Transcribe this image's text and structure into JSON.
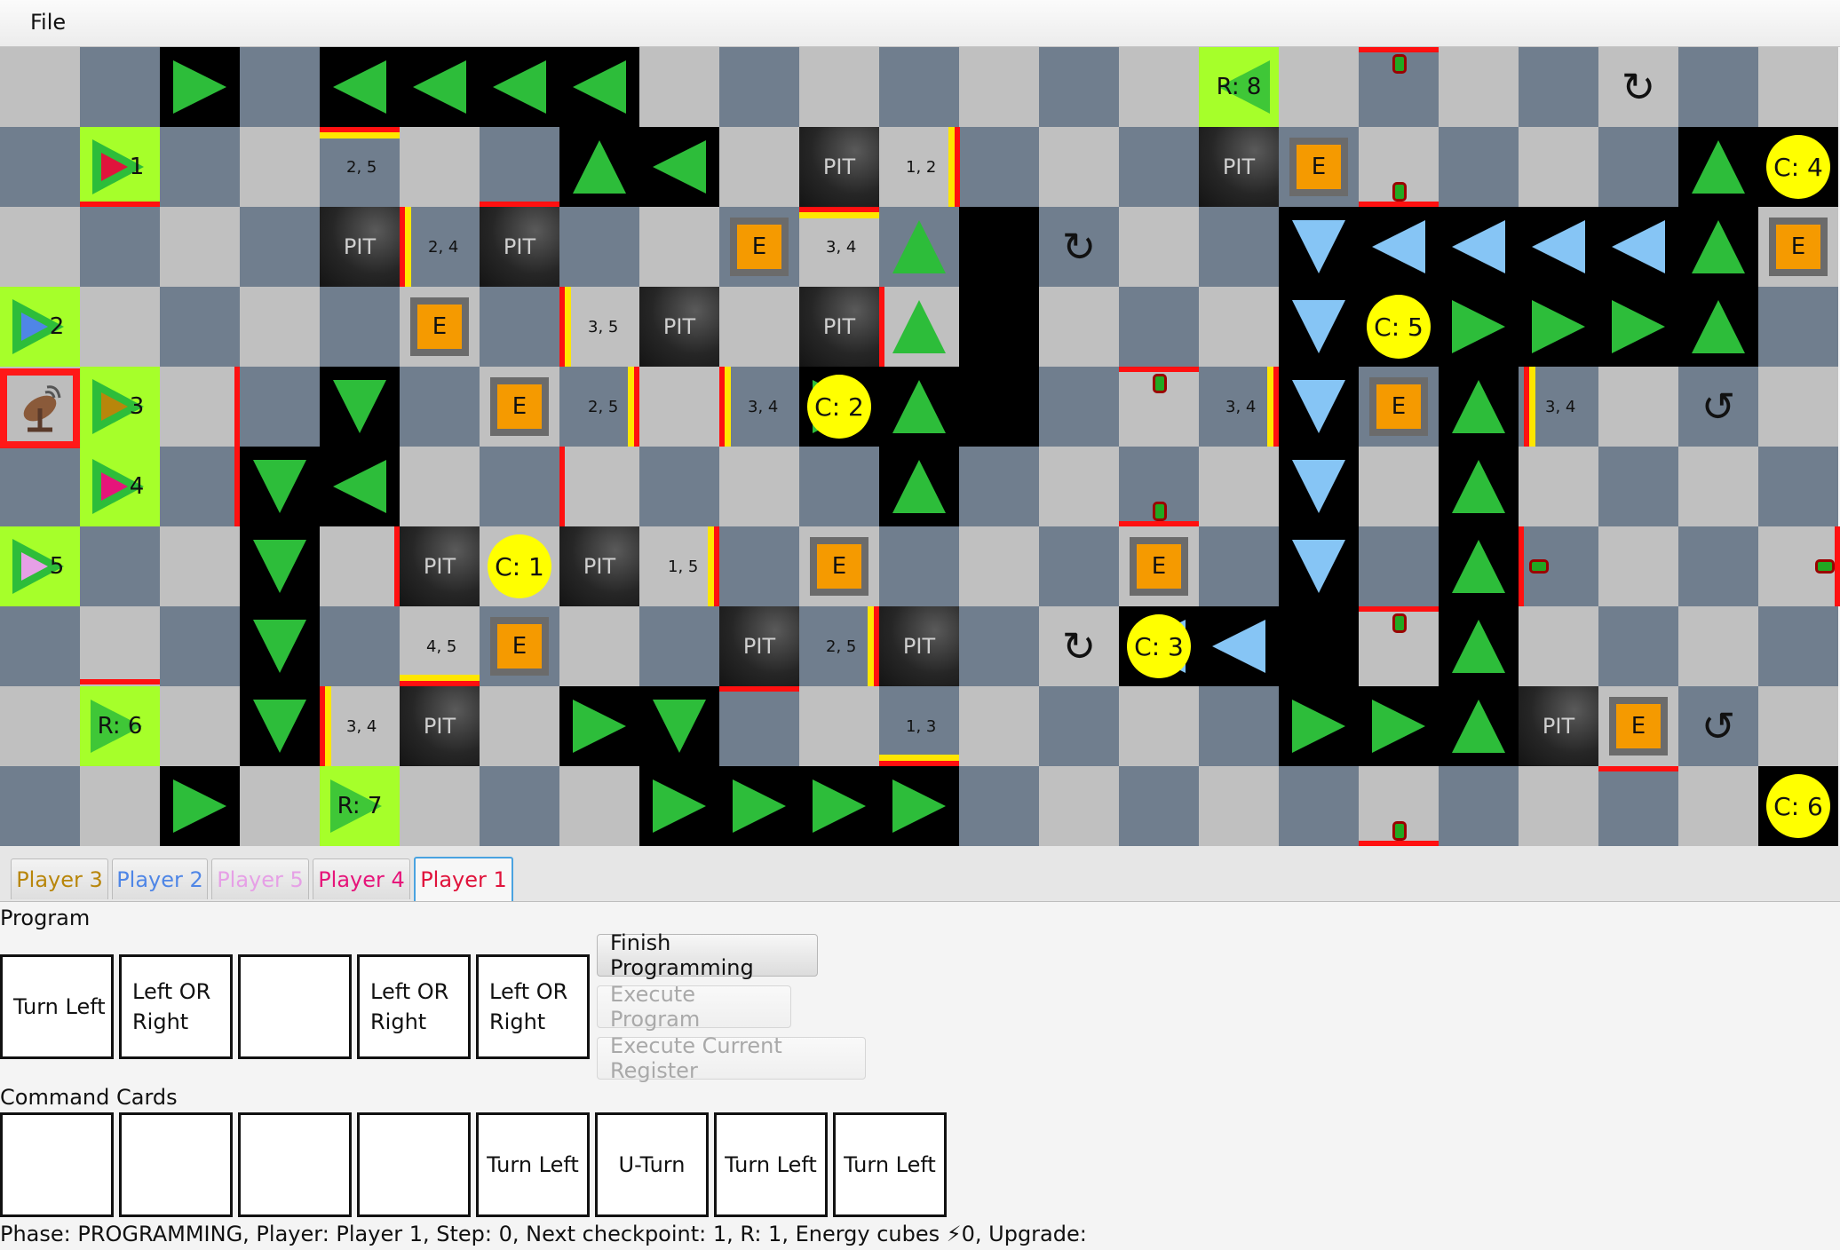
{
  "menu": {
    "file": "File"
  },
  "board": {
    "walls": {
      "w1": "2, 5",
      "w2": "1, 2",
      "w3": "2, 4",
      "w4": "3, 4",
      "w5": "3, 5",
      "w6": "2, 5",
      "w7": "3, 4",
      "w8": "3, 4",
      "w9": "3, 4",
      "w10": "1, 5",
      "w11": "4, 5",
      "w12": "2, 5",
      "w13": "3, 4",
      "w14": "1, 3"
    },
    "pit": "PIT",
    "energy": "E",
    "checkpoints": {
      "c1": "C: 1",
      "c2": "C: 2",
      "c3": "C: 3",
      "c4": "C: 4",
      "c5": "C: 5",
      "c6": "C: 6"
    },
    "reboot": {
      "r6": "R: 6",
      "r7": "R: 7",
      "r8": "R: 8"
    },
    "start": {
      "s1": "1",
      "s2": "2",
      "s3": "3",
      "s4": "4",
      "s5": "5"
    },
    "colors": {
      "belt_green": "#2dbd3a",
      "belt_blue": "#86c5f5",
      "reboot": "#a6ff2a",
      "checkpoint": "#ffff00",
      "energy": "#f59a00"
    }
  },
  "tabs": [
    {
      "label": "Player 3",
      "color": "#b8860b"
    },
    {
      "label": "Player 2",
      "color": "#4f86e6"
    },
    {
      "label": "Player 5",
      "color": "#e6a0e6"
    },
    {
      "label": "Player 4",
      "color": "#e6157a"
    },
    {
      "label": "Player 1",
      "color": "#e0143c"
    }
  ],
  "program": {
    "title": "Program",
    "registers": [
      "Turn Left",
      "Left OR Right",
      "",
      "Left OR Right",
      "Left OR Right"
    ],
    "finish": "Finish Programming",
    "execute": "Execute Program",
    "execute_current": "Execute Current Register"
  },
  "command": {
    "title": "Command Cards",
    "cards": [
      "",
      "",
      "",
      "",
      "Turn Left",
      "U-Turn",
      "Turn Left",
      "Turn Left"
    ]
  },
  "status": "Phase: PROGRAMMING, Player: Player 1, Step: 0, Next checkpoint: 1, R: 1, Energy cubes ⚡0, Upgrade:"
}
